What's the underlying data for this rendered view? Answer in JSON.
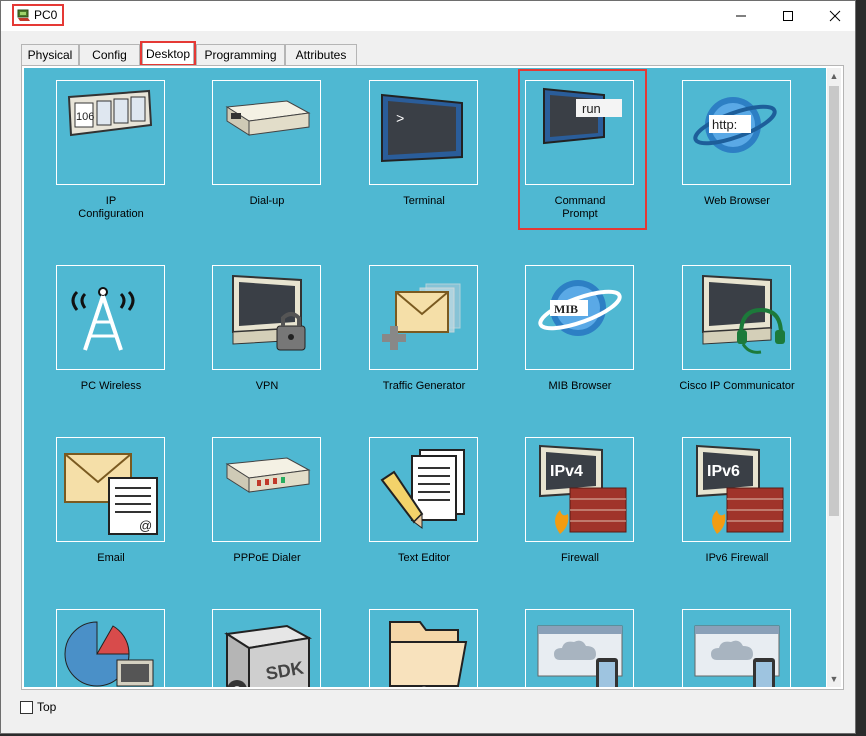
{
  "window": {
    "title": "PC0",
    "controls": {
      "minimize": "—",
      "maximize": "☐",
      "close": "✕"
    }
  },
  "tabs": [
    {
      "label": "Physical"
    },
    {
      "label": "Config"
    },
    {
      "label": "Desktop",
      "active": true
    },
    {
      "label": "Programming"
    },
    {
      "label": "Attributes"
    }
  ],
  "apps": [
    {
      "label": "IP\nConfiguration",
      "icon": "ip-config-icon",
      "screen_text": "106"
    },
    {
      "label": "Dial-up",
      "icon": "modem-icon"
    },
    {
      "label": "Terminal",
      "icon": "terminal-icon",
      "screen_text": ">"
    },
    {
      "label": "Command\nPrompt",
      "icon": "command-prompt-icon",
      "screen_text": "run"
    },
    {
      "label": "Web Browser",
      "icon": "globe-icon",
      "screen_text": "http:"
    },
    {
      "label": "PC Wireless",
      "icon": "wireless-tower-icon"
    },
    {
      "label": "VPN",
      "icon": "vpn-lock-icon"
    },
    {
      "label": "Traffic Generator",
      "icon": "traffic-generator-icon"
    },
    {
      "label": "MIB Browser",
      "icon": "mib-globe-icon",
      "screen_text": "MIB"
    },
    {
      "label": "Cisco IP Communicator",
      "icon": "headset-monitor-icon"
    },
    {
      "label": "Email",
      "icon": "email-icon",
      "screen_text": "@"
    },
    {
      "label": "PPPoE Dialer",
      "icon": "pppoe-modem-icon"
    },
    {
      "label": "Text Editor",
      "icon": "text-editor-icon"
    },
    {
      "label": "Firewall",
      "icon": "firewall-icon",
      "screen_text": "IPv4"
    },
    {
      "label": "IPv6 Firewall",
      "icon": "ipv6-firewall-icon",
      "screen_text": "IPv6"
    },
    {
      "label": "",
      "icon": "pie-chart-computer-icon"
    },
    {
      "label": "",
      "icon": "sdk-box-icon",
      "screen_text": "SDK"
    },
    {
      "label": "",
      "icon": "folder-icon"
    },
    {
      "label": "",
      "icon": "cloud-phone-icon"
    },
    {
      "label": "",
      "icon": "cloud-phone-icon-2"
    }
  ],
  "bottom": {
    "top_label": "Top",
    "top_checked": false
  },
  "colors": {
    "desktop_bg": "#4fb8d2",
    "highlight": "#e53935"
  }
}
